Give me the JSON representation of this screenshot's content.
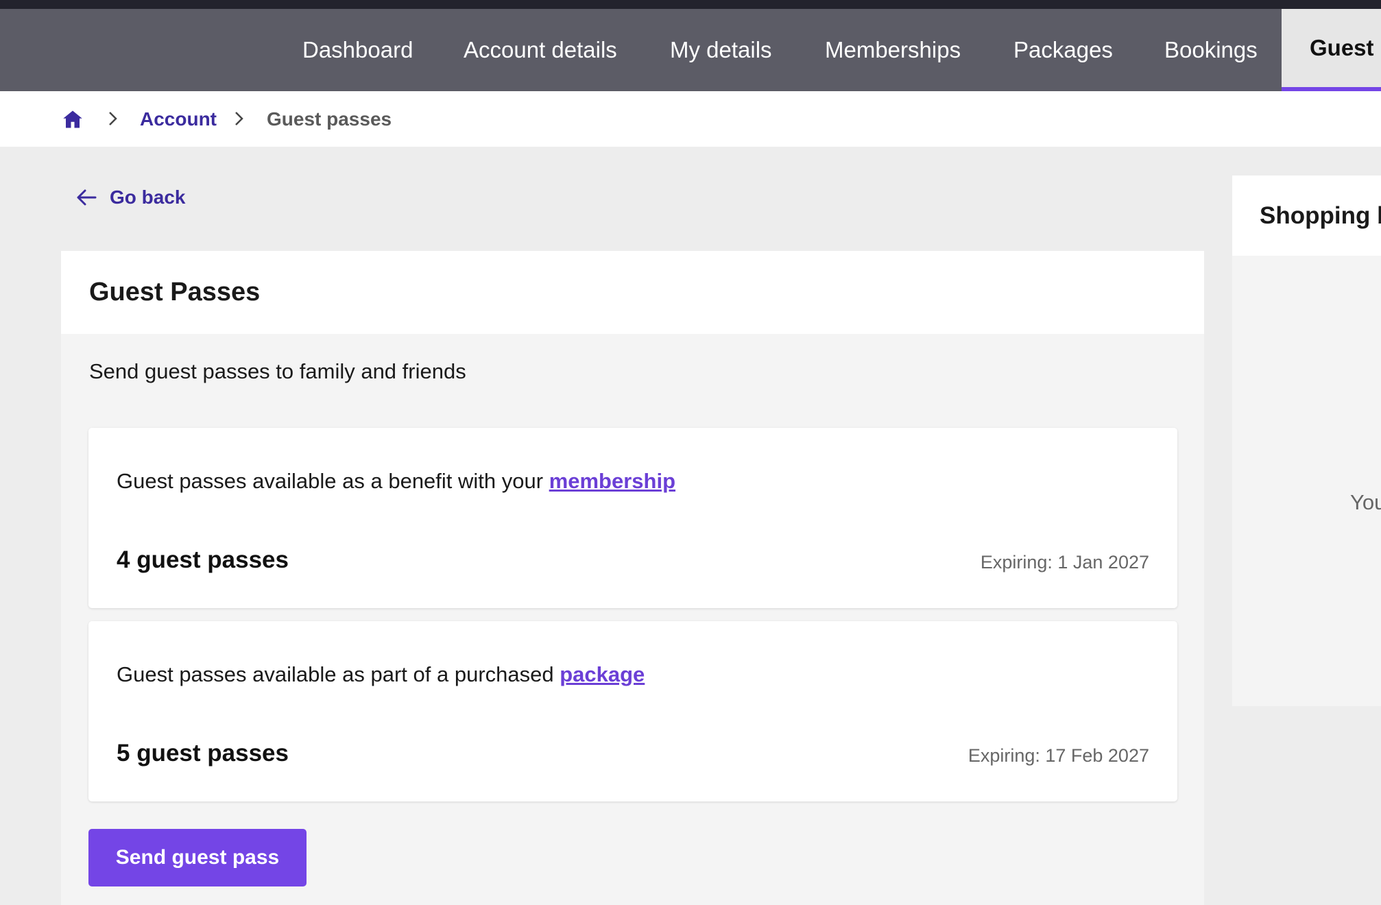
{
  "nav": {
    "items": [
      {
        "label": "Dashboard"
      },
      {
        "label": "Account details"
      },
      {
        "label": "My details"
      },
      {
        "label": "Memberships"
      },
      {
        "label": "Packages"
      },
      {
        "label": "Bookings"
      },
      {
        "label": "Guest p"
      }
    ],
    "active_index": 6
  },
  "breadcrumb": {
    "home_icon": "home-icon",
    "account": "Account",
    "current": "Guest passes"
  },
  "go_back": {
    "label": "Go back",
    "icon": "arrow-left-icon"
  },
  "guest_passes": {
    "title": "Guest Passes",
    "intro": "Send guest passes to family and friends",
    "cards": [
      {
        "description": "Guest passes available as a benefit with your ",
        "link": "membership",
        "count": "4 guest passes",
        "expiry": "Expiring: 1 Jan 2027"
      },
      {
        "description": "Guest passes available as part of a purchased ",
        "link": "package",
        "count": "5 guest passes",
        "expiry": "Expiring: 17 Feb 2027"
      }
    ],
    "send_button": "Send guest pass"
  },
  "shopping": {
    "title": "Shopping b",
    "text": "You"
  },
  "colors": {
    "navbar": "#5c5c66",
    "accent": "#7445e6",
    "link": "#3b2b9e",
    "background": "#ededed"
  }
}
